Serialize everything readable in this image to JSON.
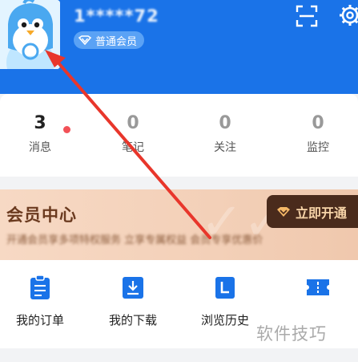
{
  "profile": {
    "username": "1*****72",
    "member_level": "普通会员"
  },
  "stats": [
    {
      "value": "3",
      "label": "消息",
      "has_dot": true
    },
    {
      "value": "0",
      "label": "笔记"
    },
    {
      "value": "0",
      "label": "关注"
    },
    {
      "value": "0",
      "label": "监控"
    }
  ],
  "vip_banner": {
    "title": "会员中心",
    "description": "开通会员享多项特权服务 立享专属权益 会员专享优惠价",
    "button_label": "立即开通"
  },
  "tools": [
    {
      "label": "我的订单",
      "icon": "order-icon"
    },
    {
      "label": "我的下载",
      "icon": "download-icon"
    },
    {
      "label": "浏览历史",
      "icon": "history-icon"
    },
    {
      "label": "",
      "icon": "ticket-icon"
    }
  ],
  "watermark": "软件技巧",
  "colors": {
    "header_bg": "#1a73e8",
    "arrow": "#e8362b",
    "vip_button": "#4a2b1c"
  }
}
